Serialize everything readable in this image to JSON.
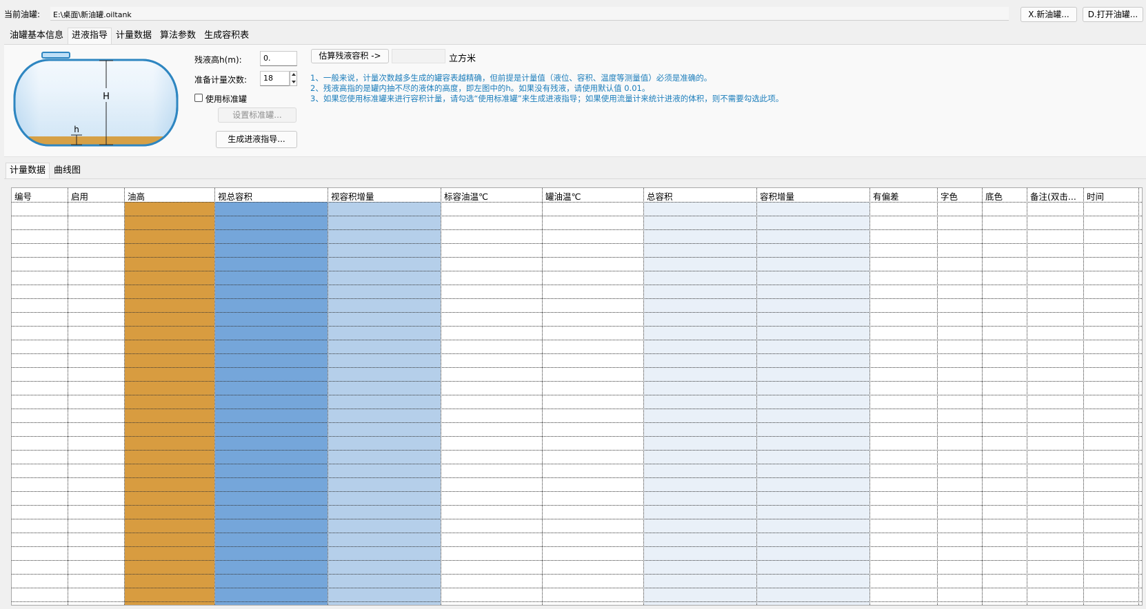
{
  "topbar": {
    "current_tank_label": "当前油罐:",
    "current_tank_path": "E:\\桌面\\新油罐.oiltank",
    "new_tank_button": "X.新油罐...",
    "open_tank_button": "D.打开油罐..."
  },
  "tabs": [
    {
      "label": "油罐基本信息"
    },
    {
      "label": "进液指导"
    },
    {
      "label": "计量数据"
    },
    {
      "label": "算法参数"
    },
    {
      "label": "生成容积表"
    }
  ],
  "active_tab": "进液指导",
  "diagram": {
    "H_label": "H",
    "h_label": "h"
  },
  "form": {
    "residual_height_label": "残液高h(m):",
    "residual_height_value": "0.",
    "count_label": "准备计量次数:",
    "count_value": "18",
    "use_standard_label": "使用标准罐",
    "use_standard_checked": false,
    "set_standard_button": "设置标准罐...",
    "generate_button": "生成进液指导...",
    "estimate_button": "估算残液容积 ->",
    "estimate_result": "",
    "unit_label": "立方米"
  },
  "hints": [
    "1、一般来说，计量次数越多生成的罐容表越精确，但前提是计量值（液位、容积、温度等测量值）必须是准确的。",
    "2、残液高指的是罐内抽不尽的液体的高度，即左图中的h。如果没有残液，请使用默认值 0.01。",
    "3、如果您使用标准罐来进行容积计量，请勾选“使用标准罐”来生成进液指导；如果使用流量计来统计进液的体积，则不需要勾选此项。"
  ],
  "subtabs": [
    {
      "label": "计量数据"
    },
    {
      "label": "曲线图"
    }
  ],
  "active_subtab": "计量数据",
  "grid": {
    "columns": [
      {
        "label": "编号",
        "color": "#ffffff"
      },
      {
        "label": "启用",
        "color": "#ffffff"
      },
      {
        "label": "油高",
        "color": "#d89c40"
      },
      {
        "label": "视总容积",
        "color": "#75a6da"
      },
      {
        "label": "视容积增量",
        "color": "#b5cfea"
      },
      {
        "label": "标容油温℃",
        "color": "#ffffff"
      },
      {
        "label": "罐油温℃",
        "color": "#ffffff"
      },
      {
        "label": "总容积",
        "color": "#e9f0f8"
      },
      {
        "label": "容积增量",
        "color": "#e9f0f8"
      },
      {
        "label": "有偏差",
        "color": "#ffffff"
      },
      {
        "label": "字色",
        "color": "#ffffff"
      },
      {
        "label": "底色",
        "color": "#ffffff"
      },
      {
        "label": "备注(双击...",
        "color": "#ffffff"
      },
      {
        "label": "时间",
        "color": "#ffffff"
      }
    ]
  }
}
